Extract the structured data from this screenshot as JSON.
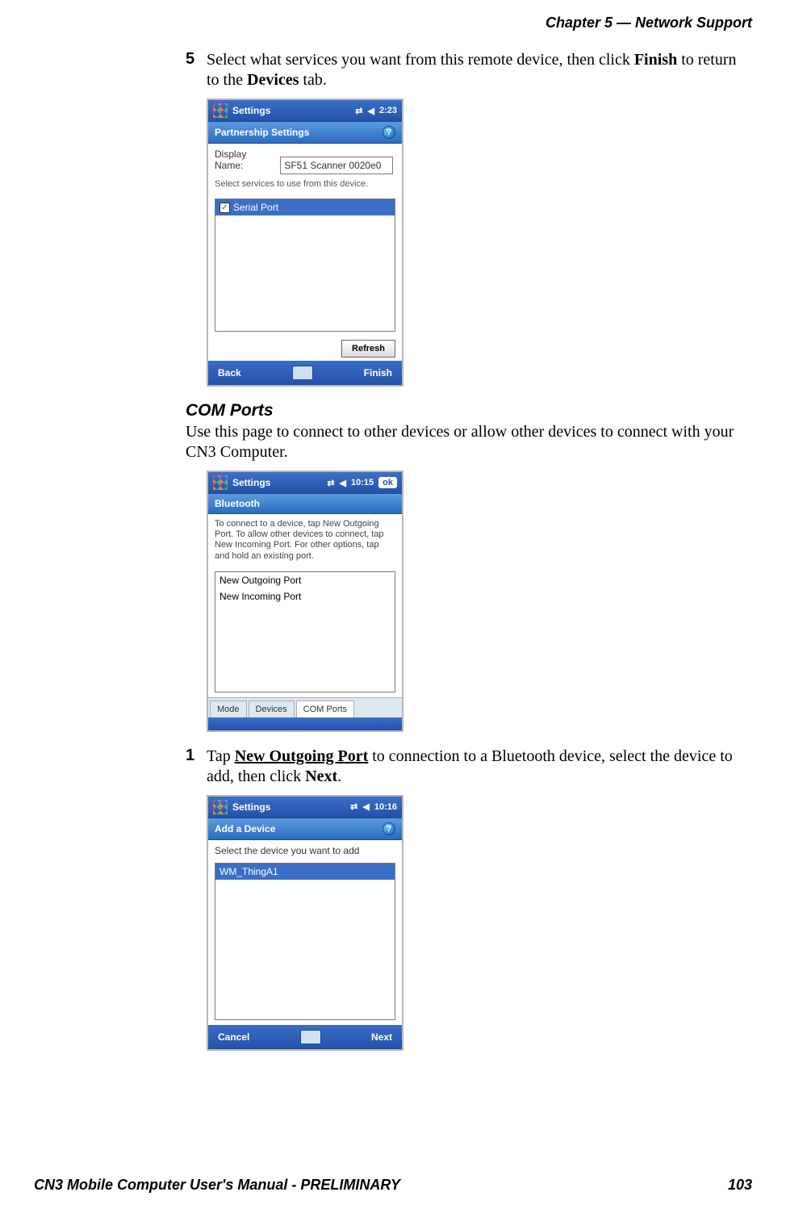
{
  "header": {
    "chapter": "Chapter 5 —  Network Support"
  },
  "step5": {
    "num": "5",
    "text_pre": "Select what services you want from this remote device, then click ",
    "bold1": "Finish",
    "text_mid": " to return to the ",
    "bold2": "Devices",
    "text_end": " tab."
  },
  "shot1": {
    "title": "Settings",
    "time": "2:23",
    "subtitle": "Partnership Settings",
    "label_displayname": "Display Name:",
    "input_value": "SF51 Scanner 0020e0",
    "hint": "Select services to use from this device.",
    "service_item": "Serial Port",
    "refresh": "Refresh",
    "soft_left": "Back",
    "soft_right": "Finish"
  },
  "com_heading": "COM Ports",
  "com_desc": "Use this page to connect to other devices or allow other devices to connect with your CN3 Computer.",
  "shot2": {
    "title": "Settings",
    "time": "10:15",
    "ok": "ok",
    "subtitle": "Bluetooth",
    "desc": "To connect to a device, tap New Outgoing Port. To allow other devices to connect, tap New Incoming Port. For other options, tap and hold an existing port.",
    "item1": "New Outgoing Port",
    "item2": "New Incoming Port",
    "tab1": "Mode",
    "tab2": "Devices",
    "tab3": "COM Ports"
  },
  "step1": {
    "num": "1",
    "text_pre": "Tap ",
    "bold1": "New Outgoing Port",
    "text_mid": " to connection to a Bluetooth device, select the device to add, then click ",
    "bold2": "Next",
    "text_end": "."
  },
  "shot3": {
    "title": "Settings",
    "time": "10:16",
    "subtitle": "Add a Device",
    "hint": "Select the device you want to add",
    "device": "WM_ThingA1",
    "soft_left": "Cancel",
    "soft_right": "Next"
  },
  "footer": {
    "manual": "CN3 Mobile Computer User's Manual - PRELIMINARY",
    "page": "103"
  }
}
